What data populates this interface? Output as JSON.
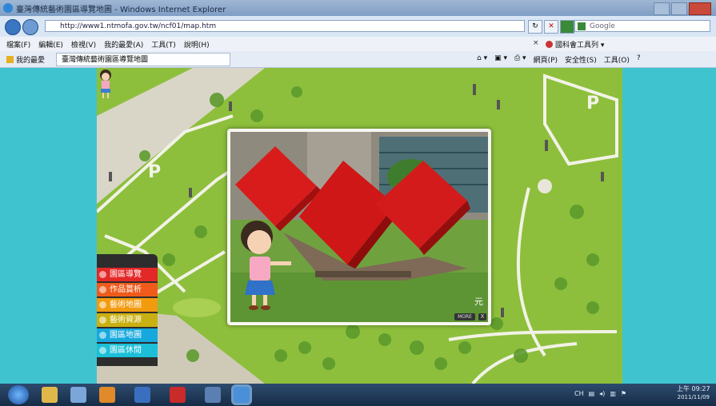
{
  "window": {
    "title": "臺灣傳統藝術園區導覽地圖 - Windows Internet Explorer"
  },
  "address": {
    "url": "http://www1.ntmofa.gov.tw/ncf01/map.htm",
    "search_placeholder": "Google"
  },
  "menu": {
    "items": [
      "檔案(F)",
      "編輯(E)",
      "檢視(V)",
      "我的最愛(A)",
      "工具(T)",
      "說明(H)"
    ],
    "toolbar_extension": "國科會工具列"
  },
  "favorites": {
    "label": "我的最愛",
    "tab_title": "臺灣傳統藝術園區導覽地圖"
  },
  "commandbar": {
    "items": [
      "網頁(P)",
      "安全性(S)",
      "工具(O)"
    ]
  },
  "map": {
    "parking_label": "P"
  },
  "popup": {
    "caption": "元",
    "more_label": "MORE",
    "close_label": "X"
  },
  "sidebar": {
    "items": [
      {
        "label": "園區導覽",
        "color": "#e42727"
      },
      {
        "label": "作品賞析",
        "color": "#f05b1b"
      },
      {
        "label": "藝術地圖",
        "color": "#f39b0f"
      },
      {
        "label": "藝術資源",
        "color": "#c9b012"
      },
      {
        "label": "園區地圖",
        "color": "#17a9de"
      },
      {
        "label": "園區休閒",
        "color": "#1bc0d8"
      }
    ]
  },
  "taskbar": {
    "tray_text": "CH",
    "time": "上午 09:27",
    "date": "2011/11/09"
  }
}
